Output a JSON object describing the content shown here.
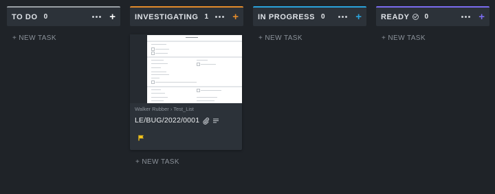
{
  "columns": [
    {
      "id": "todo",
      "title": "TO DO",
      "count": "0",
      "accent": "#9aa0a6",
      "add_color": "#ffffff",
      "new_task": "+ NEW TASK"
    },
    {
      "id": "investigating",
      "title": "INVESTIGATING",
      "count": "1",
      "accent": "#e38b2b",
      "add_color": "#e38b2b",
      "new_task": "+ NEW TASK"
    },
    {
      "id": "in_progress",
      "title": "IN PROGRESS",
      "count": "0",
      "accent": "#2aa3dc",
      "add_color": "#2aa3dc",
      "new_task": "+ NEW TASK"
    },
    {
      "id": "ready",
      "title": "READY",
      "count": "0",
      "accent": "#7b6cf0",
      "add_color": "#7b6cf0",
      "new_task": "+ NEW TASK"
    }
  ],
  "card": {
    "path": "Walker Rubber  › Test_List",
    "title": "LE/BUG/2022/0001",
    "flag_color": "#f2c21b",
    "icons": [
      "paperclip-icon",
      "description-icon",
      "flag-icon"
    ]
  },
  "icons": {
    "more": "more-dots-icon",
    "add": "plus-icon",
    "ready": "check-circle-icon"
  }
}
